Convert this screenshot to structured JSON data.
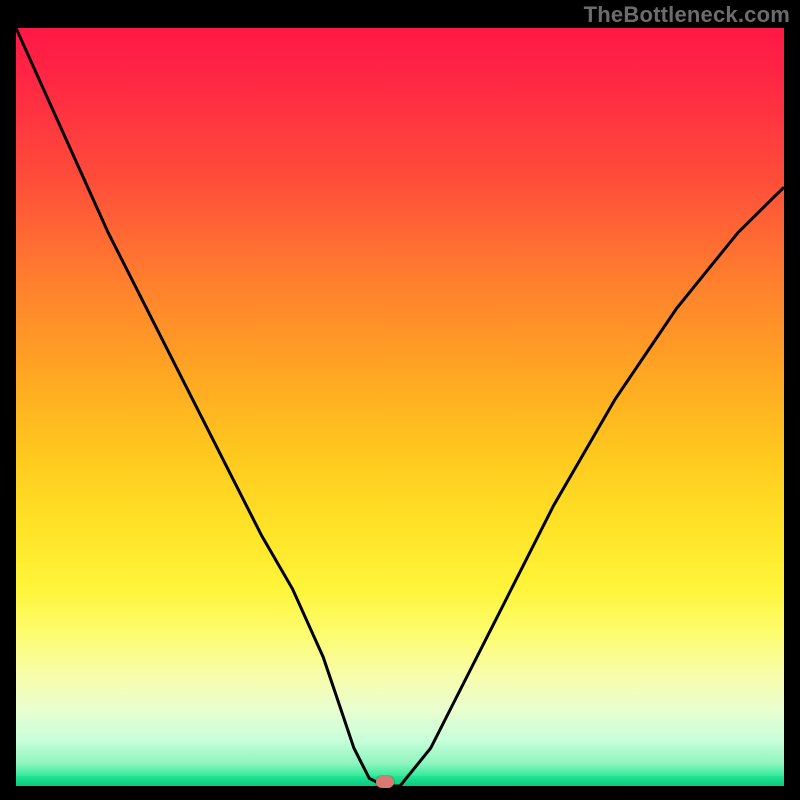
{
  "watermark": "TheBottleneck.com",
  "colors": {
    "curve_stroke": "#000000",
    "marker_fill": "#d97a72",
    "frame_bg": "#000000"
  },
  "chart_data": {
    "type": "line",
    "title": "",
    "xlabel": "",
    "ylabel": "",
    "xlim": [
      0,
      100
    ],
    "ylim": [
      0,
      100
    ],
    "axes_visible": false,
    "grid": false,
    "x": [
      0,
      4,
      8,
      12,
      16,
      20,
      24,
      28,
      32,
      36,
      40,
      42,
      44,
      46,
      48,
      50,
      54,
      58,
      62,
      66,
      70,
      74,
      78,
      82,
      86,
      90,
      94,
      98,
      100
    ],
    "values": [
      100,
      91,
      82,
      73,
      65,
      57,
      49,
      41,
      33,
      26,
      17,
      11,
      5,
      1,
      0,
      0,
      5,
      13,
      21,
      29,
      37,
      44,
      51,
      57,
      63,
      68,
      73,
      77,
      79
    ],
    "series": [
      {
        "name": "bottleneck-curve",
        "values_ref": "values"
      }
    ],
    "minimum_marker": {
      "x": 48,
      "y": 0
    },
    "background_gradient": {
      "direction": "top-to-bottom",
      "stops": [
        {
          "pos": 0,
          "color": "#ff1846"
        },
        {
          "pos": 50,
          "color": "#ffc81e"
        },
        {
          "pos": 80,
          "color": "#fdfd70"
        },
        {
          "pos": 100,
          "color": "#0cd98a"
        }
      ]
    }
  }
}
